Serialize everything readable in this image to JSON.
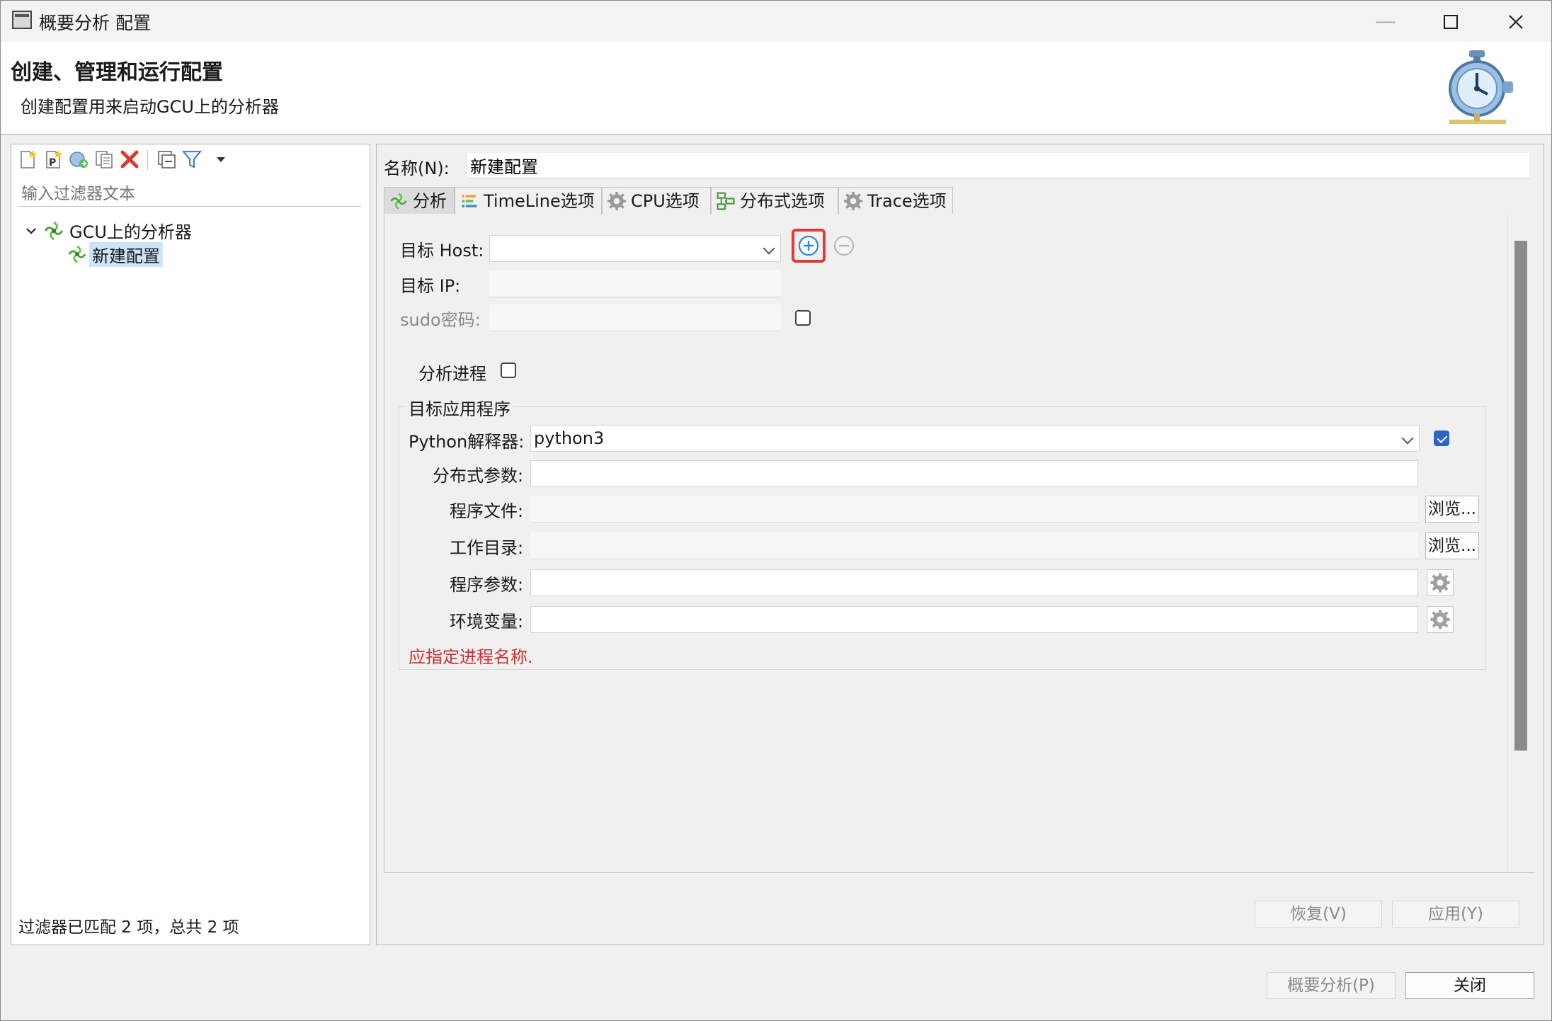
{
  "window": {
    "title": "概要分析 配置",
    "controls": [
      "minimize",
      "maximize",
      "close"
    ]
  },
  "header": {
    "title": "创建、管理和运行配置",
    "subtitle": "创建配置用来启动GCU上的分析器"
  },
  "left": {
    "toolbar": [
      "new-config-icon",
      "new-prototype-icon",
      "export-icon",
      "duplicate-icon",
      "delete-icon",
      "collapse-all-icon",
      "filter-icon",
      "dropdown-icon"
    ],
    "filter_placeholder": "输入过滤器文本",
    "tree": {
      "root": "GCU上的分析器",
      "child": "新建配置"
    },
    "status": "过滤器已匹配 2 项，总共 2 项"
  },
  "right": {
    "name_label": "名称(N):",
    "name_value": "新建配置",
    "tabs": [
      {
        "label": "分析",
        "active": true
      },
      {
        "label": "TimeLine选项",
        "active": false
      },
      {
        "label": "CPU选项",
        "active": false
      },
      {
        "label": "分布式选项",
        "active": false
      },
      {
        "label": "Trace选项",
        "active": false
      }
    ],
    "target_host_label": "目标 Host:",
    "target_host_value": "",
    "target_ip_label": "目标 IP:",
    "sudo_label": "sudo密码:",
    "sudo_checked": false,
    "analyze_process_label": "分析进程",
    "analyze_process_checked": false,
    "group_title": "目标应用程序",
    "python_label": "Python解释器:",
    "python_value": "python3",
    "python_checked": true,
    "dist_args_label": "分布式参数:",
    "program_file_label": "程序文件:",
    "work_dir_label": "工作目录:",
    "program_args_label": "程序参数:",
    "env_vars_label": "环境变量:",
    "browse_label": "浏览...",
    "error_text": "应指定进程名称.",
    "revert_label": "恢复(V)",
    "apply_label": "应用(Y)"
  },
  "footer": {
    "profile_label": "概要分析(P)",
    "close_label": "关闭"
  },
  "colors": {
    "accent": "#2f64c7",
    "error": "#d32f2f",
    "highlight": "#e53935"
  }
}
